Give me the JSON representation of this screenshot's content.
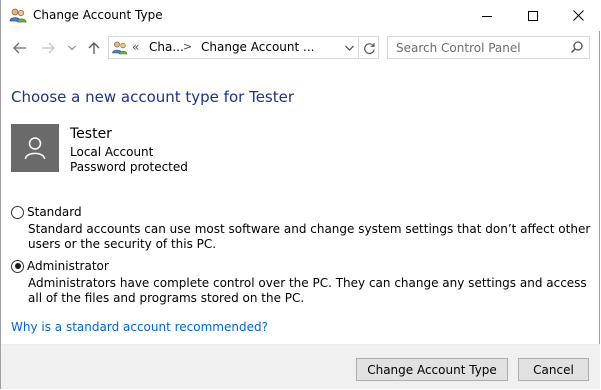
{
  "window": {
    "title": "Change Account Type",
    "title_icon": "users-icon"
  },
  "address": {
    "overflow": "«",
    "crumbs": [
      "Cha...",
      "Change Account ..."
    ],
    "separator": ">"
  },
  "search": {
    "placeholder": "Search Control Panel"
  },
  "main": {
    "heading": "Choose a new account type for Tester",
    "user": {
      "name": "Tester",
      "type": "Local Account",
      "protection": "Password protected"
    },
    "options": [
      {
        "label": "Standard",
        "description": "Standard accounts can use most software and change system settings that don’t affect other users or the security of this PC.",
        "selected": false
      },
      {
        "label": "Administrator",
        "description": "Administrators have complete control over the PC. They can change any settings and access all of the files and programs stored on the PC.",
        "selected": true
      }
    ],
    "help_link": "Why is a standard account recommended?"
  },
  "footer": {
    "primary_label": "Change Account Type",
    "cancel_label": "Cancel"
  },
  "colors": {
    "heading": "#1e3287",
    "link": "#0066cc",
    "user_tile": "#6a6a6a"
  }
}
